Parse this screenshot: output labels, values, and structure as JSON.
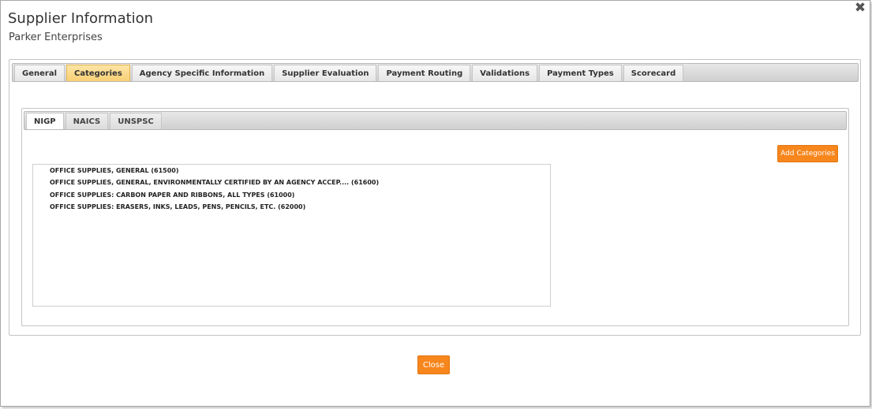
{
  "header": {
    "title": "Supplier Information",
    "subtitle": "Parker Enterprises",
    "close_icon": "✖"
  },
  "tabs": [
    {
      "label": "General",
      "active": false
    },
    {
      "label": "Categories",
      "active": true
    },
    {
      "label": "Agency Specific Information",
      "active": false
    },
    {
      "label": "Supplier Evaluation",
      "active": false
    },
    {
      "label": "Payment Routing",
      "active": false
    },
    {
      "label": "Validations",
      "active": false
    },
    {
      "label": "Payment Types",
      "active": false
    },
    {
      "label": "Scorecard",
      "active": false
    }
  ],
  "subtabs": [
    {
      "label": "NIGP",
      "active": true
    },
    {
      "label": "NAICS",
      "active": false
    },
    {
      "label": "UNSPSC",
      "active": false
    }
  ],
  "add_categories_label": "Add Categories",
  "categories": [
    "OFFICE SUPPLIES, GENERAL (61500)",
    "OFFICE SUPPLIES, GENERAL, ENVIRONMENTALLY CERTIFIED BY AN AGENCY ACCEP.... (61600)",
    "OFFICE SUPPLIES: CARBON PAPER AND RIBBONS, ALL TYPES (61000)",
    "OFFICE SUPPLIES: ERASERS, INKS, LEADS, PENS, PENCILS, ETC. (62000)"
  ],
  "footer": {
    "close_label": "Close"
  },
  "colors": {
    "accent_button": "#f7861d",
    "active_tab": "#f9cf74"
  }
}
